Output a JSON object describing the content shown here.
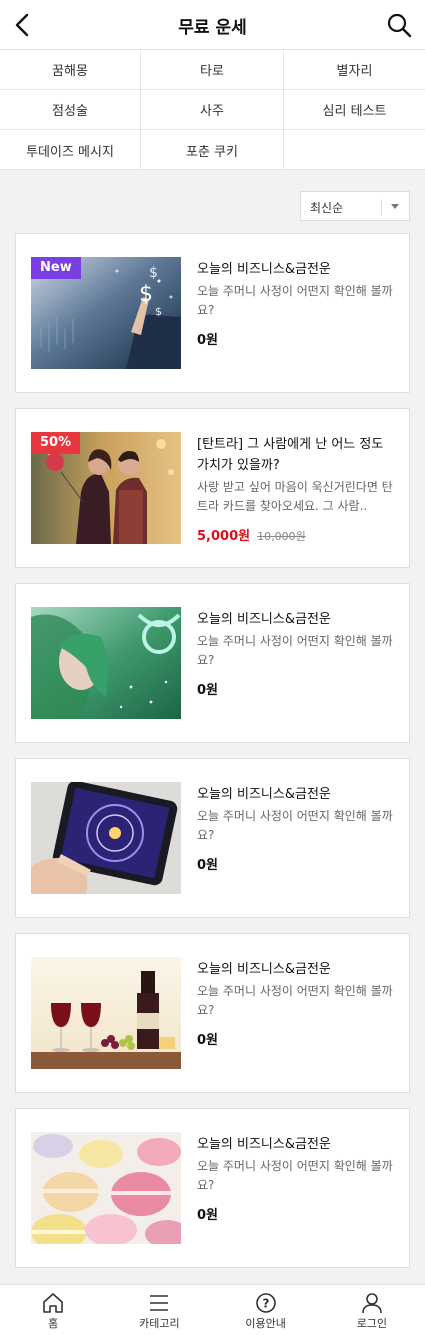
{
  "header": {
    "title": "무료 운세",
    "back_icon": "chevron-left-icon",
    "search_icon": "search-icon"
  },
  "categories": [
    "꿈해몽",
    "타로",
    "별자리",
    "점성술",
    "사주",
    "심리 테스트",
    "투데이즈 메시지",
    "포춘 쿠키",
    ""
  ],
  "sort": {
    "selected": "최신순"
  },
  "cards": [
    {
      "badge": "New",
      "title": "오늘의 비즈니스&금전운",
      "desc": "오늘 주머니 사정이 어떤지 확인해 볼까요?",
      "price": "0원",
      "orig": ""
    },
    {
      "badge": "50%",
      "title": "[탄트라] 그 사람에게 난 어느 정도 가치가 있을까?",
      "desc": "사랑 받고 싶어 마음이 욱신거린다면 탄트라 카드를 찾아오세요. 그 사람..",
      "price": "5,000원",
      "orig": "10,000원"
    },
    {
      "badge": "",
      "title": "오늘의 비즈니스&금전운",
      "desc": "오늘 주머니 사정이 어떤지 확인해 볼까요?",
      "price": "0원",
      "orig": ""
    },
    {
      "badge": "",
      "title": "오늘의 비즈니스&금전운",
      "desc": "오늘 주머니 사정이 어떤지 확인해 볼까요?",
      "price": "0원",
      "orig": ""
    },
    {
      "badge": "",
      "title": "오늘의 비즈니스&금전운",
      "desc": "오늘 주머니 사정이 어떤지 확인해 볼까요?",
      "price": "0원",
      "orig": ""
    },
    {
      "badge": "",
      "title": "오늘의 비즈니스&금전운",
      "desc": "오늘 주머니 사정이 어떤지 확인해 볼까요?",
      "price": "0원",
      "orig": ""
    }
  ],
  "tabbar": [
    {
      "label": "홈",
      "icon": "home-icon"
    },
    {
      "label": "카테고리",
      "icon": "menu-icon"
    },
    {
      "label": "이용안내",
      "icon": "help-icon"
    },
    {
      "label": "로그인",
      "icon": "user-icon"
    }
  ],
  "colors": {
    "new_badge": "#7a3fe0",
    "sale_badge": "#e8363e",
    "sale_price": "#d8101d"
  }
}
